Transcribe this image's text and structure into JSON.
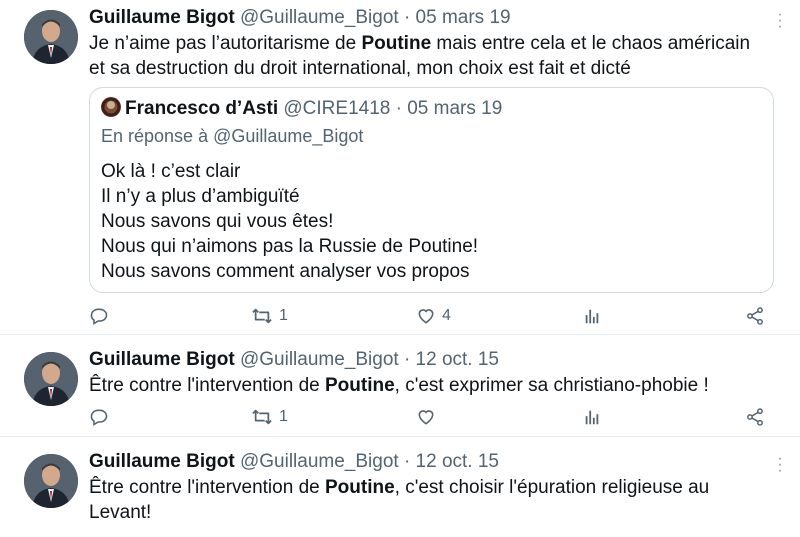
{
  "tweets": [
    {
      "author": "Guillaume Bigot",
      "meta": "@Guillaume_Bigot · 05 mars 19",
      "text_before": "Je n’aime pas l’autoritarisme de ",
      "highlight": "Poutine",
      "text_after": " mais entre cela et le chaos américain et sa destruction du droit international,  mon choix est fait et dicté",
      "quote": {
        "author": "Francesco d’Asti",
        "meta": "@CIRE1418 · 05 mars 19",
        "reply_to": "En réponse à @Guillaume_Bigot",
        "lines": [
          "Ok là ! c’est clair",
          "Il n’y a plus d’ambiguïté",
          "Nous savons qui vous êtes!",
          "Nous qui n’aimons pas la Russie de Poutine!",
          "Nous savons comment analyser vos propos"
        ]
      },
      "retweets": "1",
      "likes": "4"
    },
    {
      "author": "Guillaume Bigot",
      "meta": "@Guillaume_Bigot · 12 oct. 15",
      "text_before": "Être contre l'intervention de ",
      "highlight": "Poutine",
      "text_after": ", c'est exprimer sa christiano-phobie !",
      "retweets": "1",
      "likes": ""
    },
    {
      "author": "Guillaume Bigot",
      "meta": "@Guillaume_Bigot · 12 oct. 15",
      "text_before": "Être contre l'intervention de ",
      "highlight": "Poutine",
      "text_after": ", c'est choisir l'épuration religieuse au Levant!"
    }
  ],
  "icons": {
    "reply": "reply-icon",
    "retweet": "retweet-icon",
    "like": "heart-icon",
    "views": "views-icon",
    "share": "share-icon",
    "more": "more-icon"
  },
  "colors": {
    "text": "#0f1419",
    "muted": "#536471",
    "border": "#cfd9de",
    "divider": "#e6ecf0"
  }
}
